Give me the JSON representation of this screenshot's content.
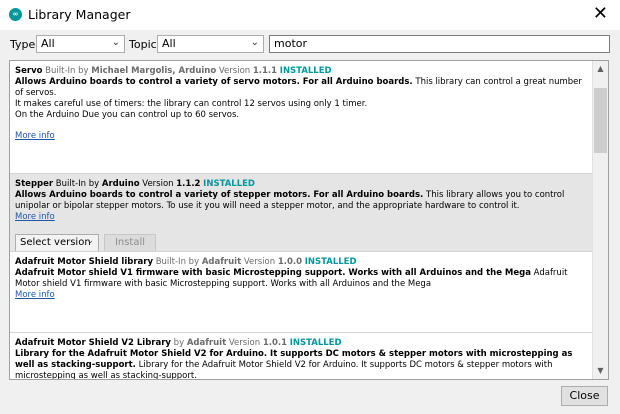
{
  "window": {
    "title": "Library Manager",
    "app_icon": "arduino-icon",
    "close_icon": "close-icon"
  },
  "filters": {
    "type_label": "Type",
    "type_value": "All",
    "topic_label": "Topic",
    "topic_value": "All",
    "search_value": "motor"
  },
  "libraries": [
    {
      "name": "Servo",
      "builtin": "Built-In",
      "by_word": "by",
      "author": "Michael Margolis, Arduino",
      "version_word": "Version",
      "version": "1.1.1",
      "status": "INSTALLED",
      "summary": "Allows Arduino boards to control a variety of servo motors. For all Arduino boards.",
      "description": "This library can control a great number of servos.",
      "extra1": "It makes careful use of timers: the library can control 12 servos using only 1 timer.",
      "extra2": "On the Arduino Due you can control up to 60 servos.",
      "more_info": "More info"
    },
    {
      "name": "Stepper",
      "builtin": "Built-In",
      "by_word": "by",
      "author": "Arduino",
      "version_word": "Version",
      "version": "1.1.2",
      "status": "INSTALLED",
      "summary": "Allows Arduino boards to control a variety of stepper motors. For all Arduino boards.",
      "description": "This library allows you to control unipolar or bipolar stepper motors. To use it you will need a stepper motor, and the appropriate hardware to control it.",
      "more_info": "More info",
      "select_version": "Select version",
      "install": "Install"
    },
    {
      "name": "Adafruit Motor Shield library",
      "builtin": "Built-In",
      "by_word": "by",
      "author": "Adafruit",
      "version_word": "Version",
      "version": "1.0.0",
      "status": "INSTALLED",
      "summary": "Adafruit Motor shield V1 firmware with basic Microstepping support. Works with all Arduinos and the Mega",
      "description": "Adafruit Motor shield V1 firmware with basic Microstepping support. Works with all Arduinos and the Mega",
      "more_info": "More info"
    },
    {
      "name": "Adafruit Motor Shield V2 Library",
      "by_word": "by",
      "author": "Adafruit",
      "version_word": "Version",
      "version": "1.0.1",
      "status": "INSTALLED",
      "summary": "Library for the Adafruit Motor Shield V2 for Arduino. It supports DC motors & stepper motors with microstepping as well as stacking-support.",
      "description": "Library for the Adafruit Motor Shield V2 for Arduino. It supports DC motors & stepper motors with microstepping as well as stacking-support."
    }
  ],
  "footer": {
    "close_label": "Close"
  }
}
